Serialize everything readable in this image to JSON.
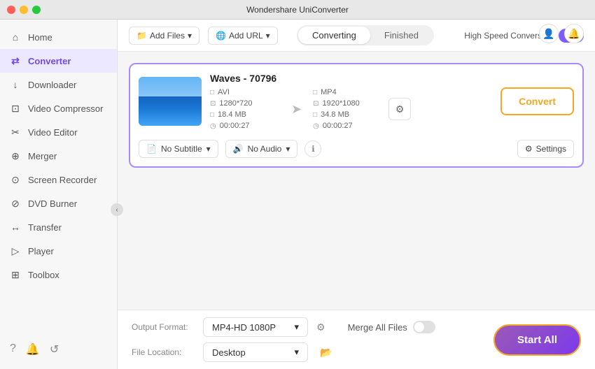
{
  "app": {
    "title": "Wondershare UniConverter",
    "window_controls": [
      "close",
      "minimize",
      "maximize"
    ]
  },
  "titlebar": {
    "title": "Wondershare UniConverter",
    "user_icon": "👤",
    "notification_icon": "🔔"
  },
  "sidebar": {
    "items": [
      {
        "id": "home",
        "label": "Home",
        "icon": "⌂",
        "active": false
      },
      {
        "id": "converter",
        "label": "Converter",
        "icon": "⇄",
        "active": true
      },
      {
        "id": "downloader",
        "label": "Downloader",
        "icon": "↓",
        "active": false
      },
      {
        "id": "video-compressor",
        "label": "Video Compressor",
        "icon": "⊡",
        "active": false
      },
      {
        "id": "video-editor",
        "label": "Video Editor",
        "icon": "✂",
        "active": false
      },
      {
        "id": "merger",
        "label": "Merger",
        "icon": "⊕",
        "active": false
      },
      {
        "id": "screen-recorder",
        "label": "Screen Recorder",
        "icon": "⊙",
        "active": false
      },
      {
        "id": "dvd-burner",
        "label": "DVD Burner",
        "icon": "⊘",
        "active": false
      },
      {
        "id": "transfer",
        "label": "Transfer",
        "icon": "↔",
        "active": false
      },
      {
        "id": "player",
        "label": "Player",
        "icon": "▷",
        "active": false
      },
      {
        "id": "toolbox",
        "label": "Toolbox",
        "icon": "⊞",
        "active": false
      }
    ],
    "footer_icons": [
      "?",
      "🔔",
      "↺"
    ]
  },
  "topbar": {
    "add_file_label": "Add Files",
    "add_url_label": "Add URL",
    "tabs": [
      {
        "id": "converting",
        "label": "Converting",
        "active": true
      },
      {
        "id": "finished",
        "label": "Finished",
        "active": false
      }
    ],
    "speed_label": "High Speed Conversion",
    "speed_enabled": true
  },
  "file_card": {
    "name": "Waves - 70796",
    "thumbnail_alt": "beach waves thumbnail",
    "source": {
      "format": "AVI",
      "resolution": "1280*720",
      "size": "18.4 MB",
      "duration": "00:00:27"
    },
    "target": {
      "format": "MP4",
      "resolution": "1920*1080",
      "size": "34.8 MB",
      "duration": "00:00:27"
    },
    "subtitle_label": "No Subtitle",
    "audio_label": "No Audio",
    "settings_label": "Settings",
    "convert_label": "Convert"
  },
  "bottom_bar": {
    "output_format_label": "Output Format:",
    "output_format_value": "MP4-HD 1080P",
    "file_location_label": "File Location:",
    "file_location_value": "Desktop",
    "merge_label": "Merge All Files",
    "merge_enabled": false,
    "start_label": "Start All"
  }
}
